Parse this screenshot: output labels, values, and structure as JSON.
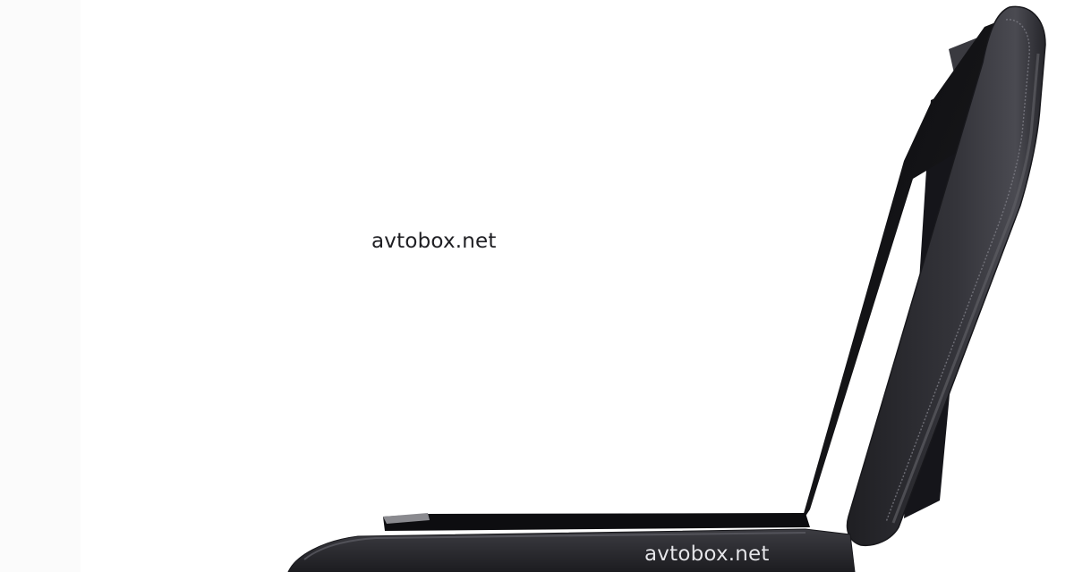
{
  "image": {
    "subject": "open car armrest console",
    "colors": {
      "background": "#ffffff",
      "leather": "#2b2b30",
      "leather_highlight": "#55555c",
      "stitching": "#8a8a90",
      "interior": "#111114"
    }
  },
  "watermarks": {
    "top": "avtobox.net",
    "bottom": "avtobox.net"
  }
}
